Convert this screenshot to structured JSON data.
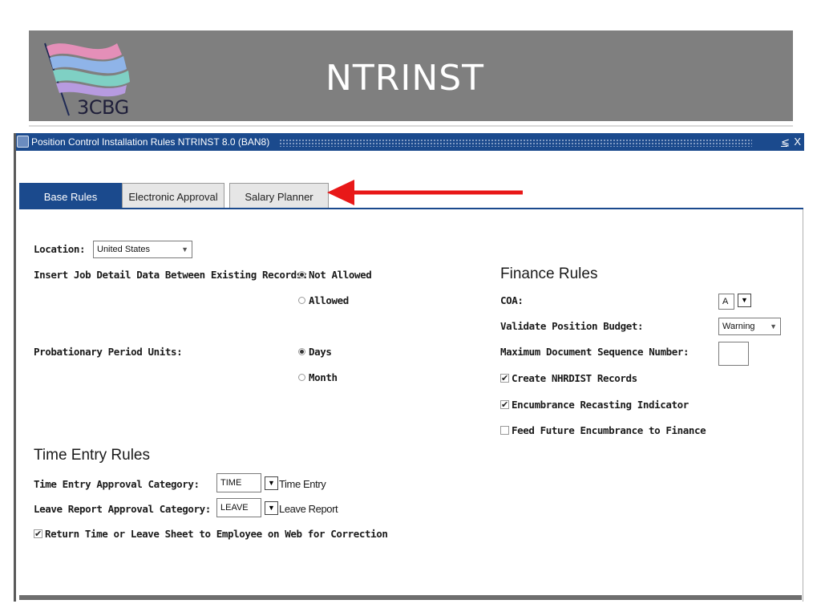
{
  "slide": {
    "title": "NTRINST",
    "logo_text": "3CBG"
  },
  "window": {
    "title": "Position Control Installation Rules  NTRINST  8.0  (BAN8)",
    "minimize": "⩽",
    "close": "X"
  },
  "tabs": [
    {
      "label": "Base Rules",
      "active": true
    },
    {
      "label": "Electronic Approval",
      "active": false
    },
    {
      "label": "Salary Planner",
      "active": false
    }
  ],
  "base": {
    "location_label": "Location:",
    "location_value": "United States",
    "insert_label": "Insert Job Detail Data Between Existing Records:",
    "insert_options": [
      "Not Allowed",
      "Allowed"
    ],
    "insert_selected": "Not Allowed",
    "prob_label": "Probationary Period Units:",
    "prob_options": [
      "Days",
      "Month"
    ],
    "prob_selected": "Days"
  },
  "finance": {
    "heading": "Finance Rules",
    "coa_label": "COA:",
    "coa_value": "A",
    "budget_label": "Validate Position Budget:",
    "budget_value": "Warning",
    "max_doc_label": "Maximum Document Sequence Number:",
    "max_doc_value": "",
    "checks": [
      {
        "label": "Create NHRDIST Records",
        "checked": true
      },
      {
        "label": "Encumbrance Recasting Indicator",
        "checked": true
      },
      {
        "label": "Feed Future Encumbrance to Finance",
        "checked": false
      }
    ]
  },
  "time_entry": {
    "heading": "Time Entry Rules",
    "time_label": "Time Entry Approval Category:",
    "time_value": "TIME",
    "time_desc": "Time Entry",
    "leave_label": "Leave Report Approval Category:",
    "leave_value": "LEAVE",
    "leave_desc": "Leave Report",
    "return_label": "Return Time or Leave Sheet to Employee on Web for Correction",
    "return_checked": true
  },
  "colors": {
    "titlebar": "#1b4a8d",
    "header": "#7f7f7f",
    "arrow": "#e81818"
  },
  "icons": {
    "dropdown": "▼",
    "check": "✔"
  }
}
